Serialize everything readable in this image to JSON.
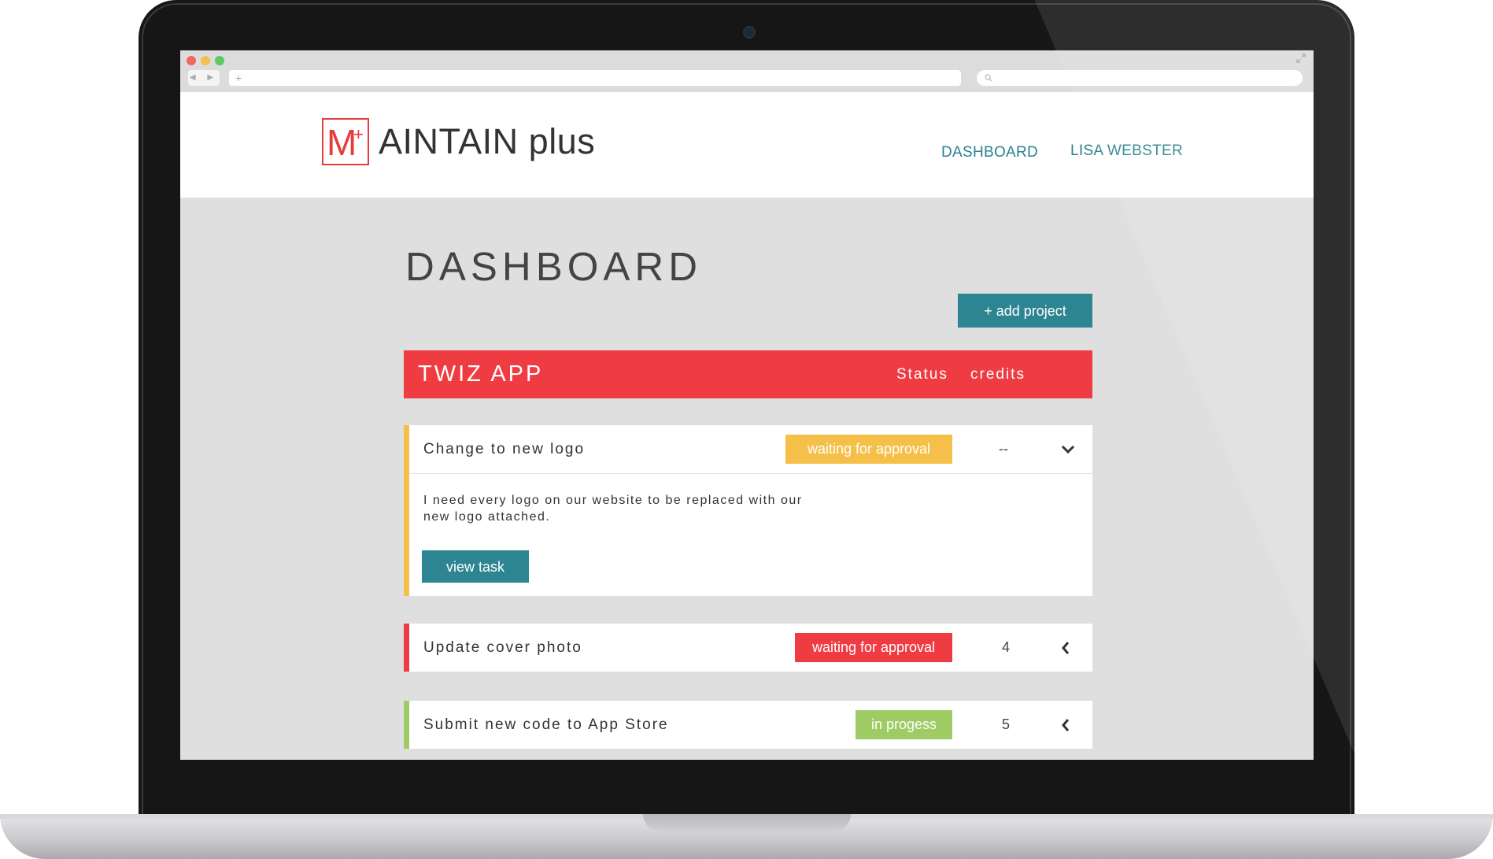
{
  "browser": {
    "nav_arrows": "◀ ▶",
    "address_plus": "+",
    "search_icon": "search-icon",
    "expand_icon": "expand-icon"
  },
  "header": {
    "logo_letter": "M",
    "logo_plus": "+",
    "logo_text": "AINTAIN plus",
    "nav": {
      "dashboard": "DASHBOARD",
      "user": "LISA WEBSTER"
    }
  },
  "main": {
    "title": "DASHBOARD",
    "add_project_label": "+ add project"
  },
  "project": {
    "name": "TWIZ APP",
    "status_label": "Status",
    "credits_label": "credits",
    "color": "#ef3c43",
    "tasks": [
      {
        "title": "Change to new logo",
        "status": "waiting for approval",
        "status_color": "#f5c04a",
        "credits": "--",
        "expanded": true,
        "chevron": "chevron-down-icon",
        "description": "I need every logo on our website to be replaced with our new logo attached.",
        "view_label": "view task"
      },
      {
        "title": "Update cover photo",
        "status": "waiting for approval",
        "status_color": "#ef3c43",
        "credits": "4",
        "expanded": false,
        "chevron": "chevron-left-icon"
      },
      {
        "title": "Submit new code to App Store",
        "status": "in progess",
        "status_color": "#9ecb64",
        "credits": "5",
        "expanded": false,
        "chevron": "chevron-left-icon"
      }
    ]
  },
  "colors": {
    "accent_teal": "#2d8592",
    "brand_red": "#e63c3c",
    "page_bg": "#e0dfdf"
  }
}
